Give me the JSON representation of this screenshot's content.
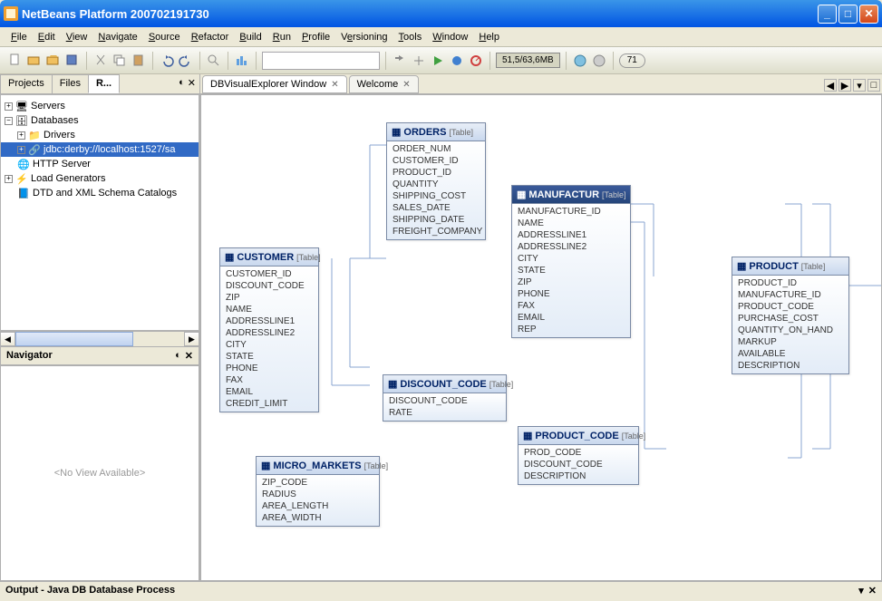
{
  "window": {
    "title": "NetBeans Platform 200702191730"
  },
  "menu": [
    "File",
    "Edit",
    "View",
    "Navigate",
    "Source",
    "Refactor",
    "Build",
    "Run",
    "Profile",
    "Versioning",
    "Tools",
    "Window",
    "Help"
  ],
  "toolbar": {
    "memory": "51,5/63,6MB",
    "spinner": "71"
  },
  "leftTabs": {
    "projects": "Projects",
    "files": "Files",
    "runtime": "R..."
  },
  "tree": {
    "servers": "Servers",
    "databases": "Databases",
    "drivers": "Drivers",
    "derby": "jdbc:derby://localhost:1527/sa",
    "http": "HTTP Server",
    "load": "Load Generators",
    "dtd": "DTD and XML Schema Catalogs"
  },
  "navigator": {
    "title": "Navigator",
    "empty": "<No View Available>"
  },
  "editorTabs": {
    "dbvisual": "DBVisualExplorer Window",
    "welcome": "Welcome"
  },
  "tables": {
    "orders": {
      "name": "ORDERS",
      "fields": [
        "ORDER_NUM",
        "CUSTOMER_ID",
        "PRODUCT_ID",
        "QUANTITY",
        "SHIPPING_COST",
        "SALES_DATE",
        "SHIPPING_DATE",
        "FREIGHT_COMPANY"
      ]
    },
    "customer": {
      "name": "CUSTOMER",
      "fields": [
        "CUSTOMER_ID",
        "DISCOUNT_CODE",
        "ZIP",
        "NAME",
        "ADDRESSLINE1",
        "ADDRESSLINE2",
        "CITY",
        "STATE",
        "PHONE",
        "FAX",
        "EMAIL",
        "CREDIT_LIMIT"
      ]
    },
    "manufacturer": {
      "name": "MANUFACTUR",
      "fields": [
        "MANUFACTURE_ID",
        "NAME",
        "ADDRESSLINE1",
        "ADDRESSLINE2",
        "CITY",
        "STATE",
        "ZIP",
        "PHONE",
        "FAX",
        "EMAIL",
        "REP"
      ]
    },
    "product": {
      "name": "PRODUCT",
      "fields": [
        "PRODUCT_ID",
        "MANUFACTURE_ID",
        "PRODUCT_CODE",
        "PURCHASE_COST",
        "QUANTITY_ON_HAND",
        "MARKUP",
        "AVAILABLE",
        "DESCRIPTION"
      ]
    },
    "discount_code": {
      "name": "DISCOUNT_CODE",
      "fields": [
        "DISCOUNT_CODE",
        "RATE"
      ]
    },
    "product_code": {
      "name": "PRODUCT_CODE",
      "fields": [
        "PROD_CODE",
        "DISCOUNT_CODE",
        "DESCRIPTION"
      ]
    },
    "micro_markets": {
      "name": "MICRO_MARKETS",
      "fields": [
        "ZIP_CODE",
        "RADIUS",
        "AREA_LENGTH",
        "AREA_WIDTH"
      ]
    },
    "tag": "[Table]"
  },
  "output": {
    "title": "Output - Java DB Database Process"
  }
}
